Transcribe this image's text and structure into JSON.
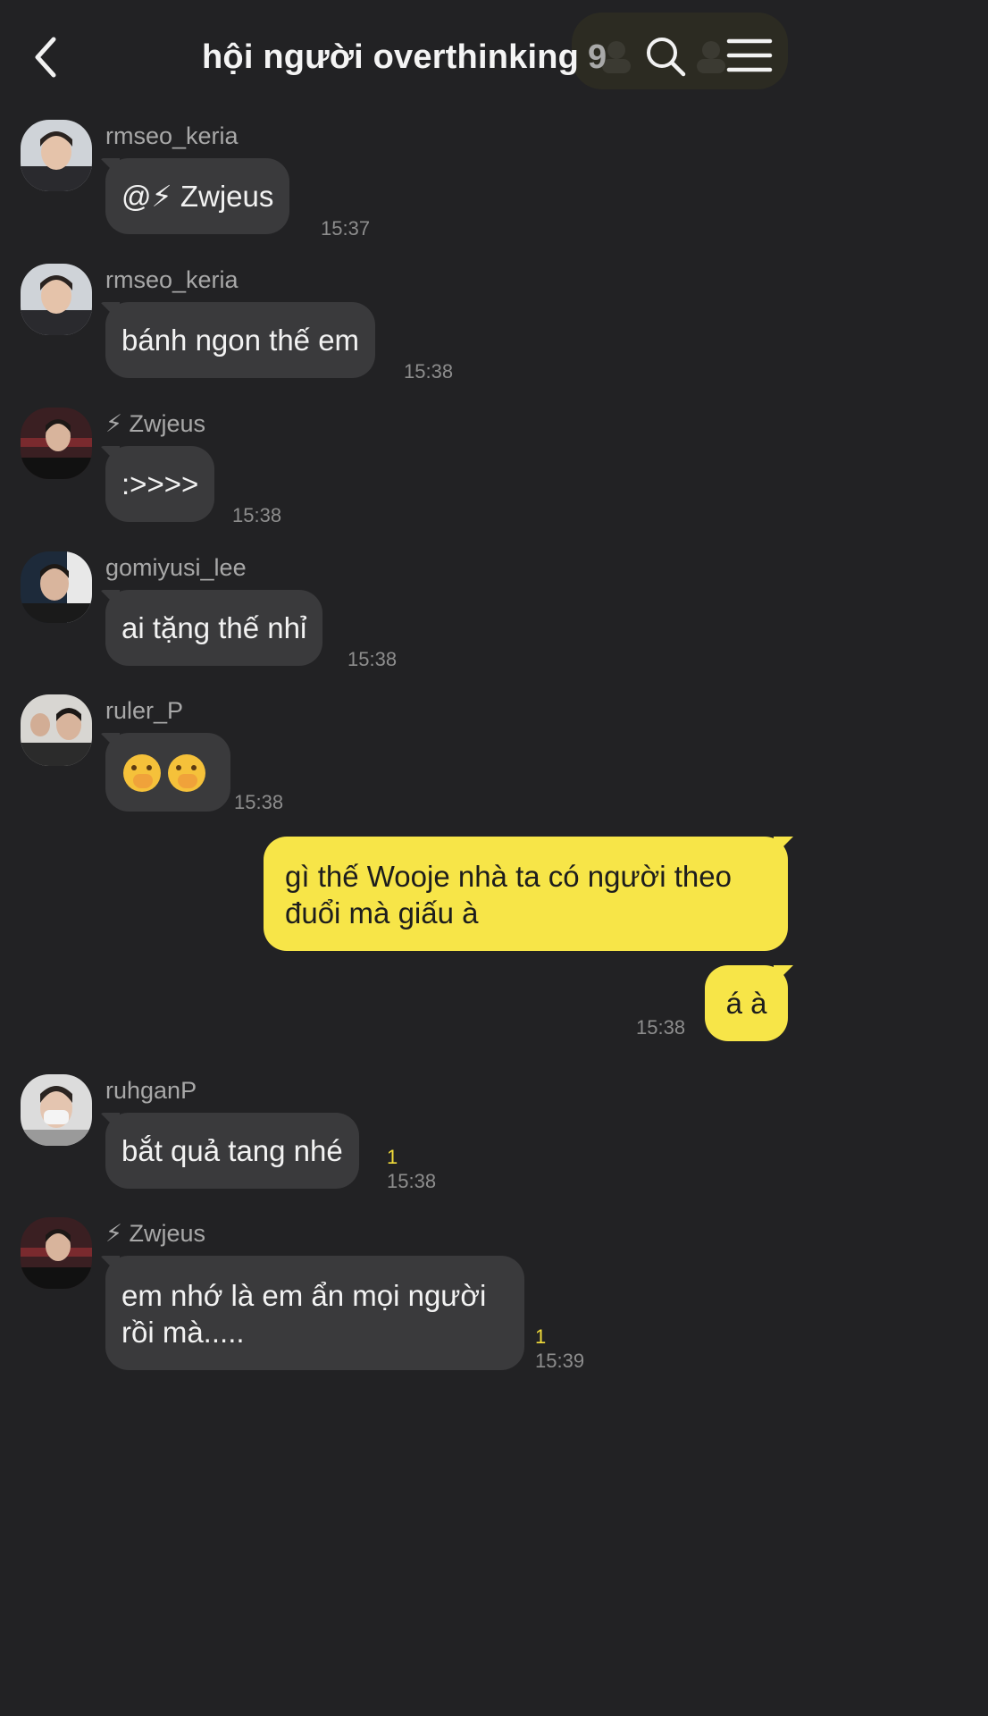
{
  "header": {
    "title": "hội người overthinking",
    "member_count": "9",
    "back_icon": "chevron-left-icon",
    "search_icon": "search-icon",
    "menu_icon": "hamburger-menu-icon"
  },
  "colors": {
    "background": "#222224",
    "incoming_bubble": "#3a3a3c",
    "outgoing_bubble": "#f7e548",
    "unread_indicator": "#f2dc3a"
  },
  "messages": [
    {
      "sender": "rmseo_keria",
      "text": "@⚡ Zwjeus",
      "time": "15:37"
    },
    {
      "sender": "rmseo_keria",
      "text": "bánh ngon thế em",
      "time": "15:38"
    },
    {
      "sender": "⚡ Zwjeus",
      "text": ":>>>>",
      "time": "15:38"
    },
    {
      "sender": "gomiyusi_lee",
      "text": "ai tặng thế nhỉ",
      "time": "15:38"
    },
    {
      "sender": "ruler_P",
      "text": "",
      "emoji": "face-with-hand-over-mouth ×2",
      "time": "15:38"
    },
    {
      "outgoing": true,
      "text_line1": "gì thế Wooje nhà ta có người theo",
      "text_line2": "đuổi mà giấu à"
    },
    {
      "outgoing": true,
      "text": "á à",
      "time": "15:38"
    },
    {
      "sender": "ruhganP",
      "text": "bắt quả tang nhé",
      "time": "15:38",
      "unread": "1"
    },
    {
      "sender": "⚡ Zwjeus",
      "text_line1": "em nhớ là em ẩn mọi người",
      "text_line2": "rồi mà.....",
      "time": "15:39",
      "unread": "1"
    }
  ]
}
